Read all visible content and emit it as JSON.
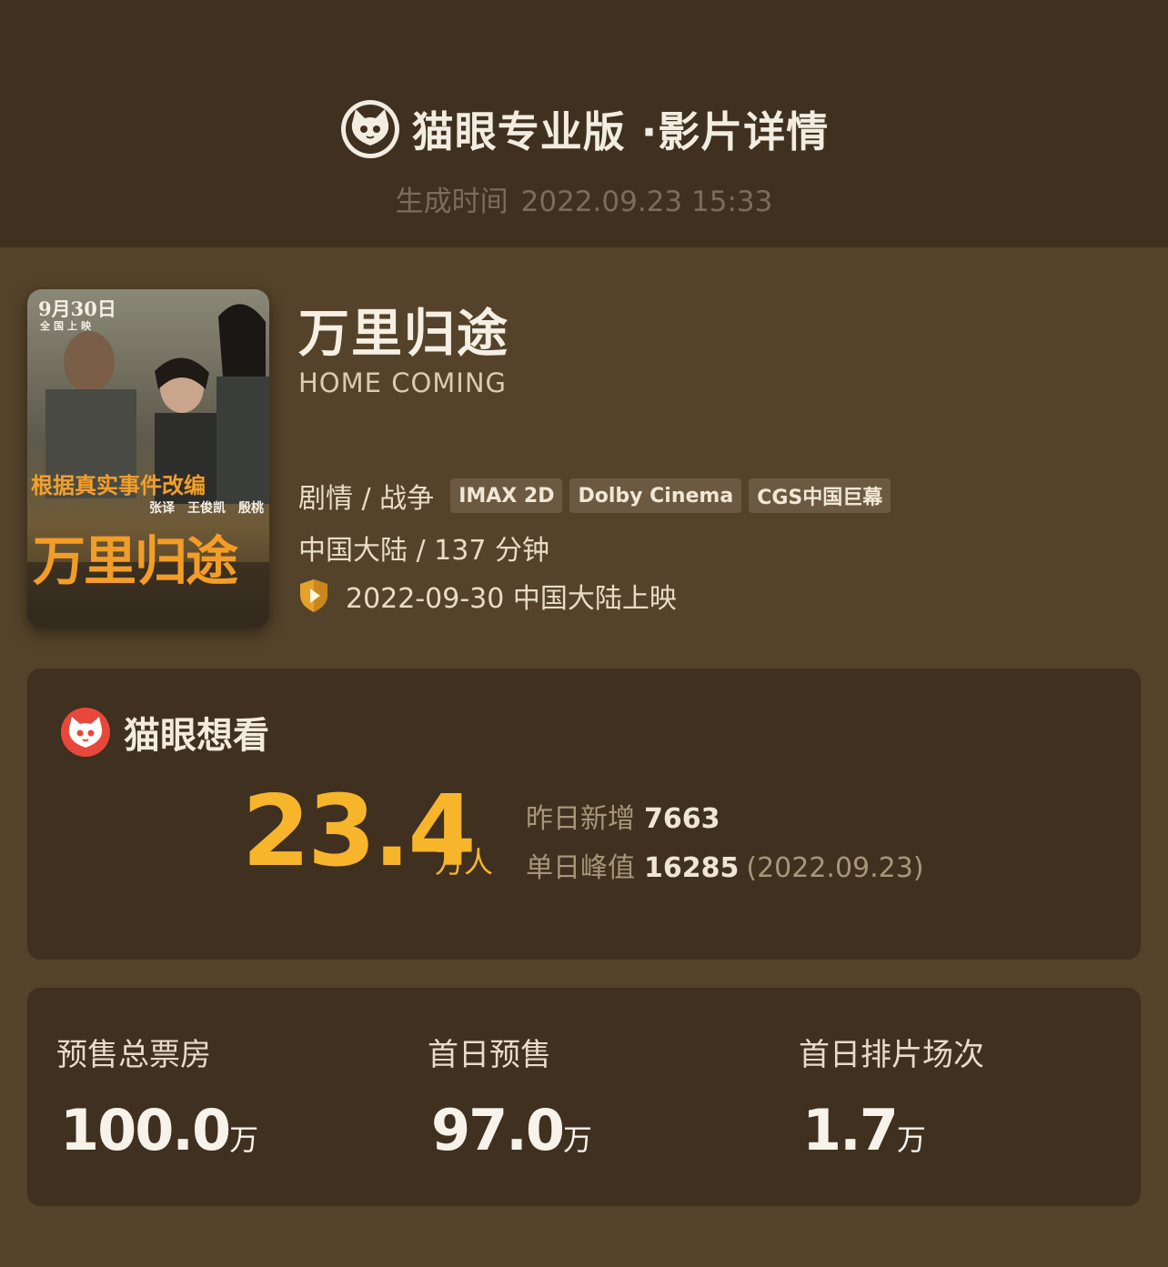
{
  "header": {
    "brand": "猫眼专业版 ·影片详情",
    "generated_label": "生成时间",
    "generated_time": "2022.09.23 15:33"
  },
  "poster": {
    "date_line": "9月30日",
    "date_sub": "全国上映",
    "tagline": "根据真实事件改编",
    "cast": "张译　王俊凯　殷桃",
    "big_title": "万里归途"
  },
  "movie": {
    "title": "万里归途",
    "english_title": "HOME COMING",
    "genres": "剧情 / 战争",
    "tags": [
      "IMAX 2D",
      "Dolby Cinema",
      "CGS中国巨幕"
    ],
    "origin_duration": "中国大陆 / 137 分钟",
    "release": "2022-09-30 中国大陆上映"
  },
  "want": {
    "label": "猫眼想看",
    "total": "23.4",
    "unit": "万人",
    "yesterday_label": "昨日新增",
    "yesterday_value": "7663",
    "peak_label": "单日峰值",
    "peak_value": "16285",
    "peak_date": "(2022.09.23)"
  },
  "stats": [
    {
      "label": "预售总票房",
      "value": "100.0",
      "unit": "万"
    },
    {
      "label": "首日预售",
      "value": "97.0",
      "unit": "万"
    },
    {
      "label": "首日排片场次",
      "value": "1.7",
      "unit": "万"
    }
  ],
  "colors": {
    "accent": "#f7b52c",
    "page_bg": "#54432a",
    "card_bg": "#3f3020",
    "maoyan_red": "#e8483b"
  },
  "icons": [
    "maoyan-cat-logo-icon",
    "shield-play-icon",
    "maoyan-red-logo-icon"
  ]
}
